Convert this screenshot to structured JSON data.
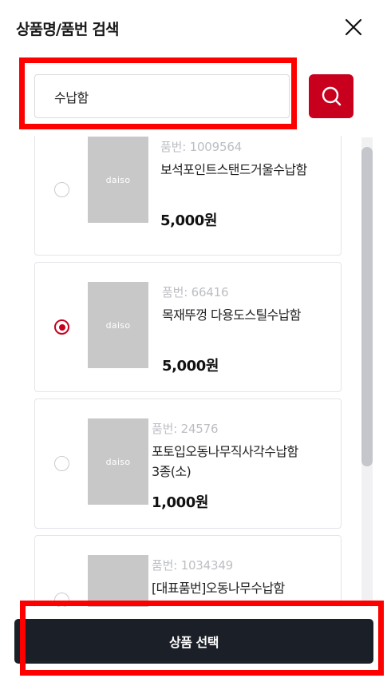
{
  "header": {
    "title": "상품명/품번 검색",
    "close_icon": "close-icon"
  },
  "search": {
    "value": "수납함",
    "button_icon": "search-icon"
  },
  "products": [
    {
      "thumb_label": "daiso",
      "code": "품번: 1009564",
      "name": "보석포인트스탠드거울수납함",
      "price": "5,000원",
      "selected": false
    },
    {
      "thumb_label": "daiso",
      "code": "품번: 66416",
      "name": "목재뚜껑 다용도스틸수납함",
      "price": "5,000원",
      "selected": true
    },
    {
      "thumb_label": "daiso",
      "code": "품번: 24576",
      "name": "포토입오동나무직사각수납함3종(소)",
      "price": "1,000원",
      "selected": false
    },
    {
      "thumb_label": "",
      "code": "품번: 1034349",
      "name": "[대표품번]오동나무수납함",
      "price": "",
      "selected": false
    }
  ],
  "footer": {
    "select_label": "상품 선택"
  },
  "colors": {
    "accent": "#c8001e",
    "button_dark": "#1b1f27",
    "highlight": "#ff0000"
  }
}
